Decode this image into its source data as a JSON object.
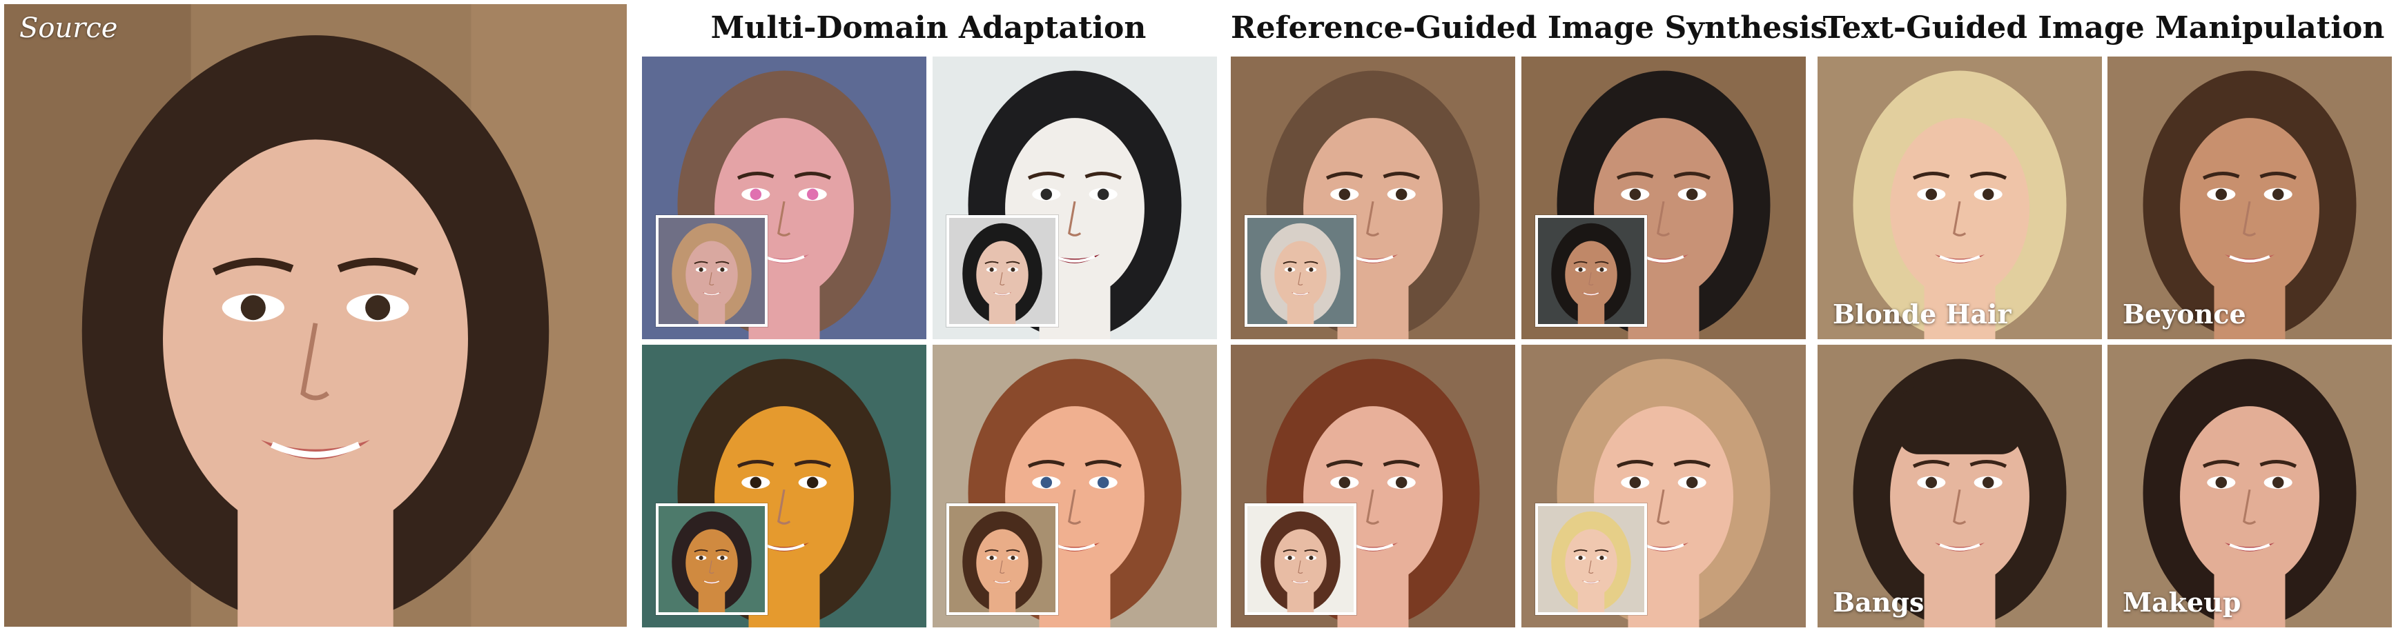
{
  "source": {
    "label": "Source"
  },
  "sections": [
    {
      "title": "Multi-Domain Adaptation"
    },
    {
      "title": "Reference-Guided Image Synthesis"
    },
    {
      "title": "Text-Guided Image Manipulation"
    }
  ],
  "text_guided": {
    "captions": [
      "Blonde Hair",
      "Beyonce",
      "Bangs",
      "Makeup"
    ]
  },
  "colors": {
    "background": "#ffffff",
    "heading": "#111111",
    "overlay_text": "#ffffff"
  }
}
